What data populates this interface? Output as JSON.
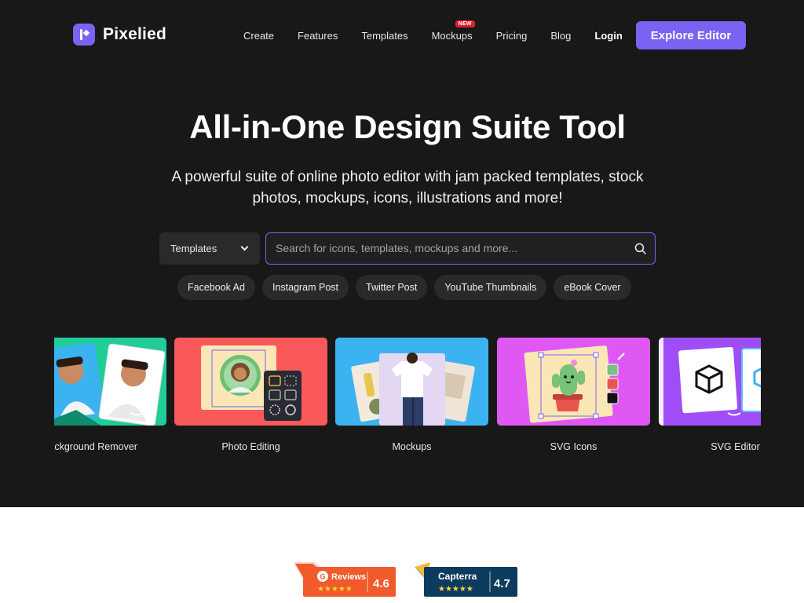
{
  "brand": {
    "name": "Pixelied",
    "accent": "#7a63f2"
  },
  "nav": {
    "items": [
      "Create",
      "Features",
      "Templates",
      "Mockups",
      "Pricing",
      "Blog"
    ],
    "new_badge": "NEW",
    "login": "Login",
    "cta": "Explore Editor"
  },
  "hero": {
    "title": "All-in-One Design Suite Tool",
    "subtitle": "A powerful suite of online photo editor with jam packed templates, stock photos, mockups, icons, illustrations and more!"
  },
  "search": {
    "category": "Templates",
    "placeholder": "Search for icons, templates, mockups and more..."
  },
  "chips": [
    "Facebook Ad",
    "Instagram Post",
    "Twitter Post",
    "YouTube Thumbnails",
    "eBook Cover"
  ],
  "cards": [
    {
      "label": "Background Remover",
      "color": "#1fcc9a"
    },
    {
      "label": "Photo Editing",
      "color": "#f9595a"
    },
    {
      "label": "Mockups",
      "color": "#3bb3f0"
    },
    {
      "label": "SVG Icons",
      "color": "#e058f3"
    },
    {
      "label": "SVG Editor",
      "color": "#9f4ef5"
    }
  ],
  "ratings": {
    "g2": {
      "name": "Reviews",
      "score": "4.6",
      "color": "#f15a2b"
    },
    "capterra": {
      "name": "Capterra",
      "score": "4.7",
      "color": "#0d3b5e"
    }
  }
}
